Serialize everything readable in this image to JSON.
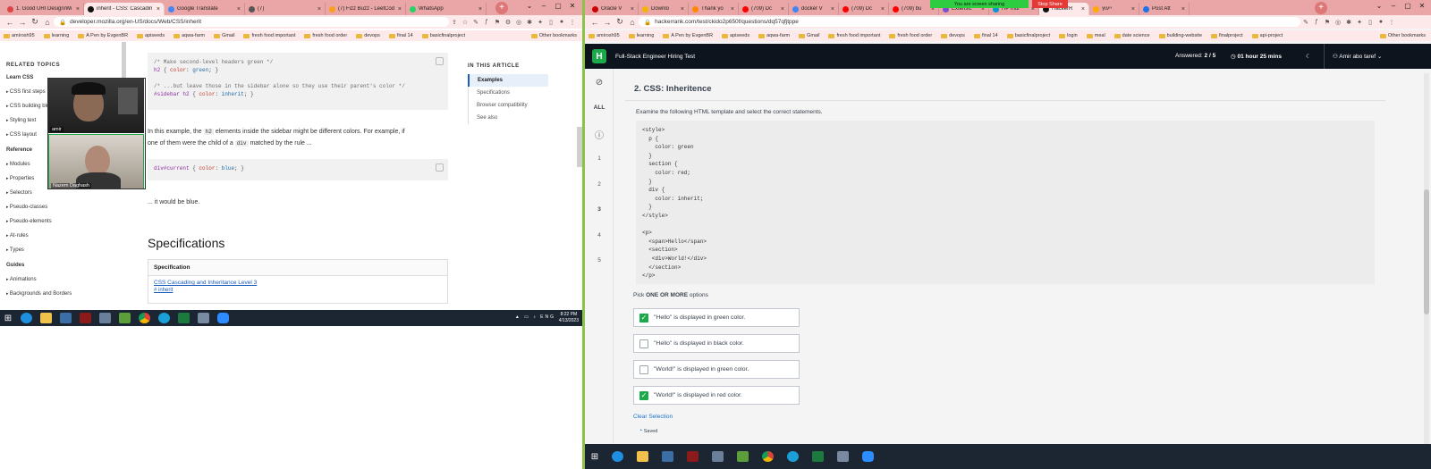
{
  "left": {
    "tabs": [
      {
        "label": "1. Good URI Design/Wi",
        "fav": "#d44"
      },
      {
        "label": "inherit - CSS: Cascadin",
        "fav": "#111",
        "active": true
      },
      {
        "label": "Google Translate",
        "fav": "#4285f4"
      },
      {
        "label": "(7)",
        "fav": "#555"
      },
      {
        "label": "(7) Fizz Buzz - LeetCod",
        "fav": "#f89f1b"
      },
      {
        "label": "WhatsApp",
        "fav": "#25d366"
      }
    ],
    "url": "developer.mozilla.org/en-US/docs/Web/CSS/inherit",
    "bookmarks": [
      "amirosh95",
      "learning",
      "A Pen by EvgenBR",
      "apiseeds",
      "aqwa-farm",
      "Gmail",
      "fresh food important",
      "fresh food order",
      "devops",
      "final 14",
      "basicfinalproject"
    ],
    "other_bookmarks": "Other bookmarks",
    "sidebar": {
      "heading": "RELATED TOPICS",
      "learn_css": "Learn CSS",
      "learn_items": [
        "CSS first steps",
        "CSS building blocks",
        "Styling text",
        "CSS layout"
      ],
      "reference": "Reference",
      "reference_items": [
        "Modules",
        "Properties",
        "Selectors",
        "Pseudo-classes",
        "Pseudo-elements",
        "At-rules",
        "Types"
      ],
      "guides": "Guides",
      "guide_items": [
        "Animations",
        "Backgrounds and Borders"
      ]
    },
    "code1": {
      "c1": "/* Make second-level headers green */",
      "s1": "h2",
      "p1": "color",
      "v1": "green",
      "c2": "/* ...but leave those in the sidebar alone so they use their parent's color */",
      "s2": "#sidebar h2",
      "p2": "color",
      "v2": "inherit"
    },
    "para1_a": "In this example, the",
    "para1_code1": "h2",
    "para1_b": "elements inside the sidebar might be different colors. For example, if",
    "para1_c": "one of them were the child of a",
    "para1_code2": "div",
    "para1_d": "matched by the rule ...",
    "code2": {
      "s": "div#current",
      "p": "color",
      "v": "blue"
    },
    "para2": "... it would be blue.",
    "spec_heading": "Specifications",
    "spec_table_header": "Specification",
    "spec_link": "CSS Cascading and Inheritance Level 3",
    "spec_anchor": "# inherit",
    "toc": {
      "heading": "IN THIS ARTICLE",
      "items": [
        "Examples",
        "Specifications",
        "Browser compatibility",
        "See also"
      ]
    },
    "video": {
      "p1": "amir",
      "p2": "Nazem Daghash"
    },
    "taskbar": {
      "lang": "ENG",
      "time": "8:22 PM",
      "date": "4/13/2023"
    }
  },
  "right": {
    "tabs": [
      {
        "label": "Oracle V",
        "fav": "#c00"
      },
      {
        "label": "Downlo",
        "fav": "#f5b400"
      },
      {
        "label": "Thank yo",
        "fav": "#f80"
      },
      {
        "label": "(709) Dc",
        "fav": "#f00"
      },
      {
        "label": "docker V",
        "fav": "#4285f4"
      },
      {
        "label": "(709) Dc",
        "fav": "#f00"
      },
      {
        "label": "(709) bu",
        "fav": "#f00"
      },
      {
        "label": "Extensic",
        "fav": "#7b4fd1"
      },
      {
        "label": "HP Indi",
        "fav": "#0096d6"
      },
      {
        "label": "HackerR",
        "fav": "#111",
        "active": true
      },
      {
        "label": "ייעוץ",
        "fav": "#fa0"
      },
      {
        "label": "Post Att",
        "fav": "#1a73e8"
      }
    ],
    "sharing": "You are screen sharing",
    "stop_share": "Stop Share",
    "url": "hackerrank.com/test/ckido2p650f/questions/dq57qfjtppe",
    "bookmarks": [
      "amirosh95",
      "learning",
      "A Pen by EvgenBR",
      "apiseeds",
      "aqwa-farm",
      "Gmail",
      "fresh food important",
      "fresh food order",
      "devops",
      "final 14",
      "basicfinalproject",
      "login",
      "meal",
      "date science",
      "building-website",
      "finalproject",
      "api-project"
    ],
    "other_bookmarks": "Other bookmarks",
    "header": {
      "title": "Full-Stack Engineer Hiring Test",
      "answered_label": "Answered:",
      "answered_value": "2 / 5",
      "timer": "01 hour 25 mins",
      "user": "Amir abo taref"
    },
    "rail": [
      "ALL",
      "1",
      "2",
      "3",
      "4",
      "5"
    ],
    "question": {
      "title": "2. CSS: Inheritence",
      "description": "Examine the following HTML template and select the correct statements.",
      "code": "<style>\n  p {\n    color: green\n  }\n  section {\n    color: red;\n  }\n  div {\n    color: inherit;\n  }\n</style>\n\n<p>\n  <span>Hello</span>\n  <section>\n   <div>World!</div>\n  </section>\n</p>",
      "pick_a": "Pick",
      "pick_b": "ONE OR MORE",
      "pick_c": "options",
      "options": [
        {
          "label": "\"Hello\" is displayed in green color.",
          "checked": true
        },
        {
          "label": "\"Hello\" is displayed in black color.",
          "checked": false
        },
        {
          "label": "\"World!\" is displayed in green color.",
          "checked": false
        },
        {
          "label": "\"World!\" is displayed in red color.",
          "checked": true
        }
      ],
      "clear": "Clear Selection",
      "saved": "Saved"
    }
  },
  "colors": {
    "accent_green": "#1ba94c",
    "tabbar": "#eaa6a6",
    "hr_header": "#0e141e"
  }
}
